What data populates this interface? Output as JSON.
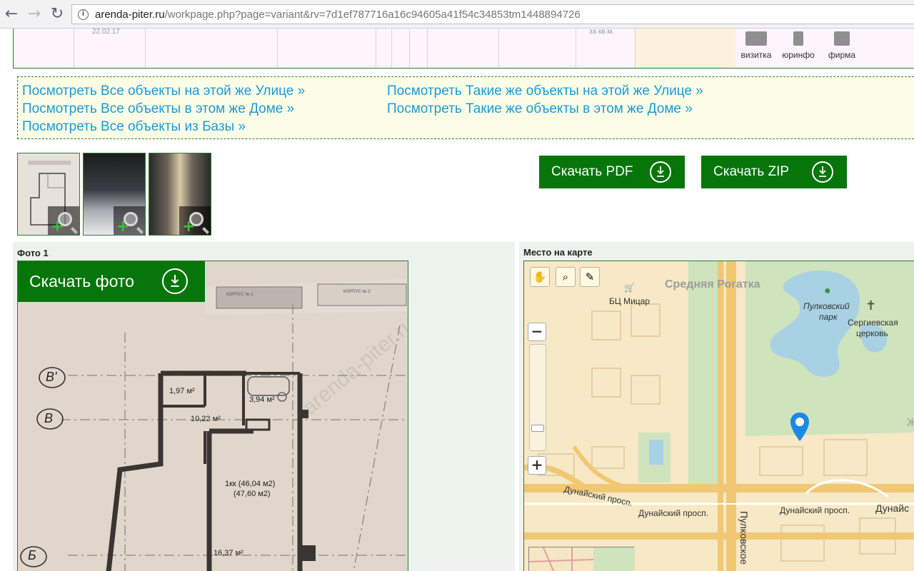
{
  "browser": {
    "url_host": "arenda-piter.ru",
    "url_path": "/workpage.php?page=variant&rv=7d1ef787716a16c94605a41f54c34853tm1448894726"
  },
  "top_table": {
    "faint_left": "22.02.17",
    "faint_right": "за кв.м.",
    "buttons": [
      {
        "label": "визитка",
        "icon": "business-card-icon"
      },
      {
        "label": "юринфо",
        "icon": "legal-info-icon"
      },
      {
        "label": "фирма",
        "icon": "company-icon"
      }
    ]
  },
  "links": {
    "left": [
      "Посмотреть Все объекты на этой же Улице »",
      "Посмотреть Все объекты в этом же Доме »",
      "Посмотреть Все объекты из Базы »"
    ],
    "right": [
      "Посмотреть Такие же объекты на этой же Улице »",
      "Посмотреть Такие же объекты в этом же Доме »"
    ]
  },
  "downloads": {
    "pdf": "Скачать PDF",
    "zip": "Скачать ZIP"
  },
  "photo_section": {
    "label": "Фото 1",
    "download_label": "Скачать фото",
    "plan": {
      "corpus_1": "КОРПУС № 1",
      "corpus_2": "КОРПУС № 2",
      "axis_b_prime": "В'",
      "axis_b": "В",
      "axis_be": "Б",
      "room_1": "1,97 м²",
      "room_2": "3,94 м²",
      "room_3": "10,22 м²",
      "room_main_1": "1кк (46,04 м2)",
      "room_main_2": "(47,60 м2)",
      "room_4": "16,37 м²",
      "watermark": "arenda-piter.ru"
    }
  },
  "map_section": {
    "label": "Место на карте",
    "district": "Средняя Рогатка",
    "poi_bc": "БЦ Мицар",
    "poi_park_1": "Пулковский",
    "poi_park_2": "парк",
    "poi_church_1": "Сергиевская",
    "poi_church_2": "церковь",
    "street_1": "Дунайский просп.",
    "street_2": "Дунайский просп.",
    "street_3": "Дунайский просп.",
    "street_4": "Дунайс",
    "street_vertical": "Пулковское",
    "edge_letter": "Ж"
  }
}
